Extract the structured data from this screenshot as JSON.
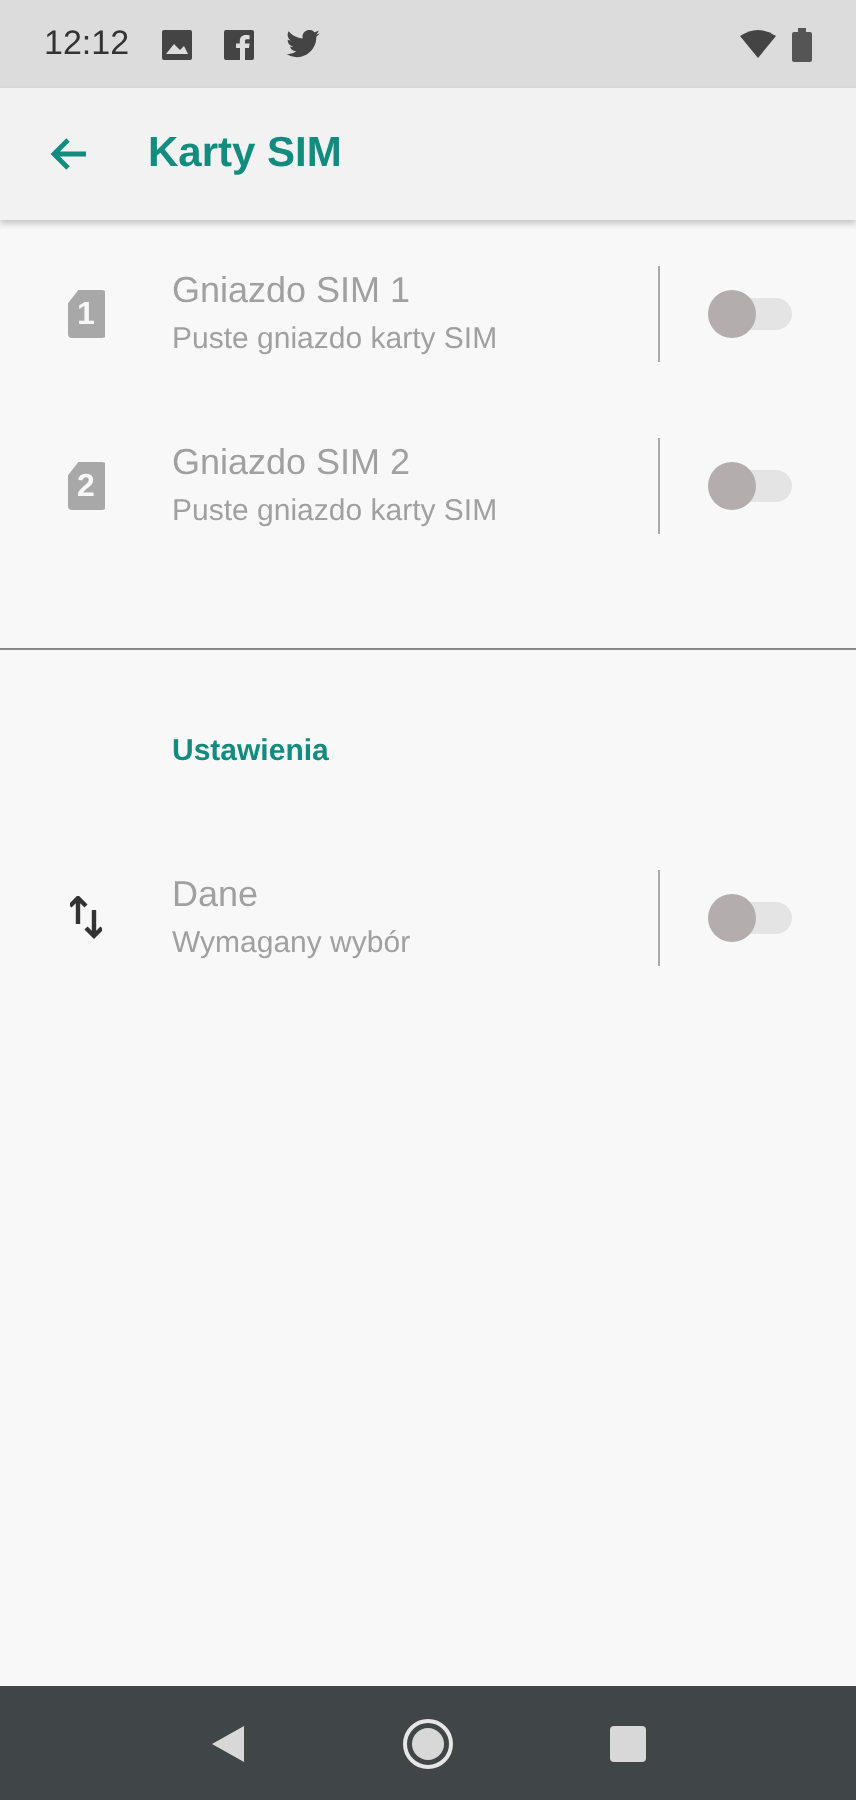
{
  "status_bar": {
    "time": "12:12"
  },
  "app_bar": {
    "title": "Karty SIM"
  },
  "sim_slots": [
    {
      "kind": "sim",
      "number": "1",
      "title": "Gniazdo SIM 1",
      "subtitle": "Puste gniazdo karty SIM",
      "disabled": true,
      "on": false
    },
    {
      "kind": "sim",
      "number": "2",
      "title": "Gniazdo SIM 2",
      "subtitle": "Puste gniazdo karty SIM",
      "disabled": true,
      "on": false
    }
  ],
  "settings": {
    "header": "Ustawienia",
    "items": [
      {
        "kind": "data",
        "title": "Dane",
        "subtitle": "Wymagany wybór",
        "disabled": true,
        "on": false
      }
    ]
  }
}
